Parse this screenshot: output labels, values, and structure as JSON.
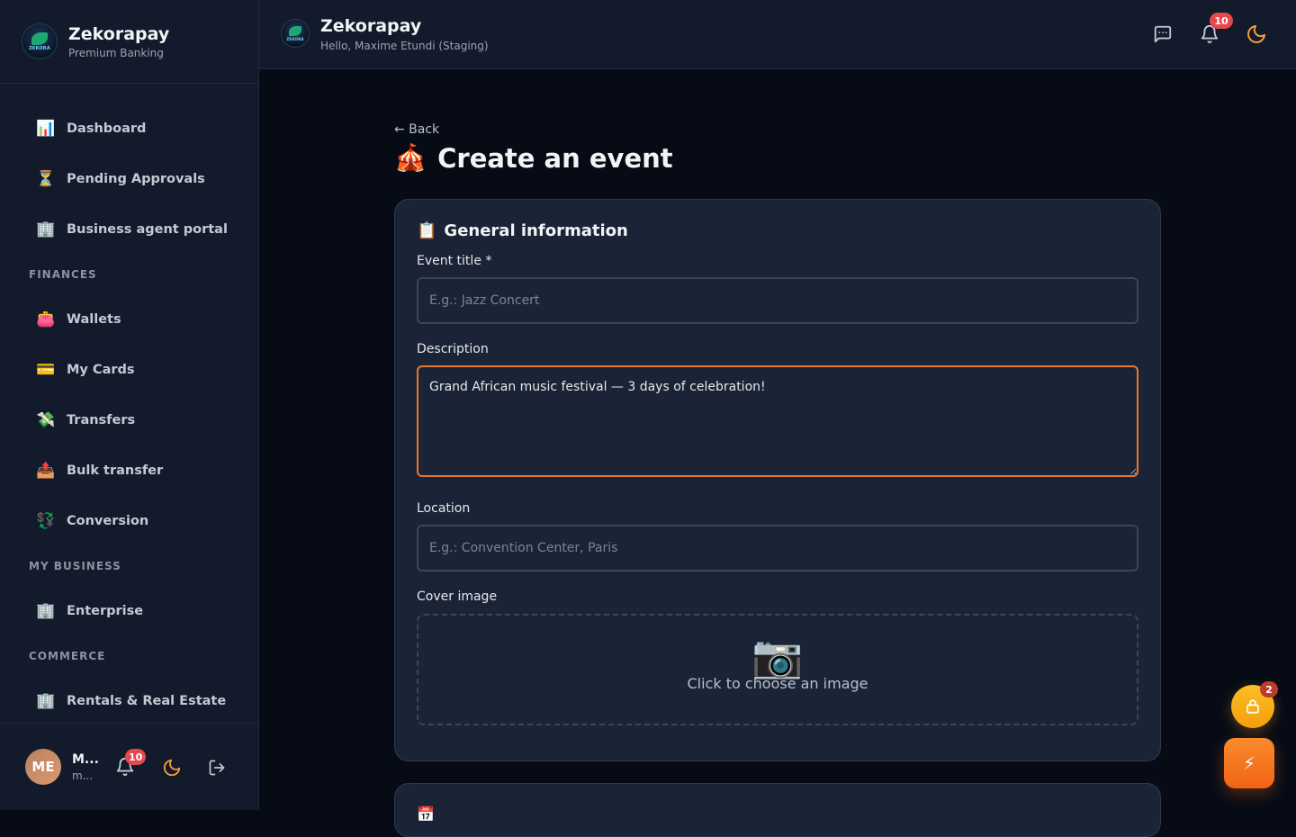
{
  "brand": {
    "name": "Zekorapay",
    "tagline": "Premium Banking",
    "logo_text": "ZEKORA"
  },
  "sidebar": {
    "items": [
      {
        "label": "Dashboard",
        "icon": "📊"
      },
      {
        "label": "Pending Approvals",
        "icon": "⏳"
      },
      {
        "label": "Business agent portal",
        "icon": "🏢"
      }
    ],
    "finances_heading": "FINANCES",
    "finances": [
      {
        "label": "Wallets",
        "icon": "👛"
      },
      {
        "label": "My Cards",
        "icon": "💳"
      },
      {
        "label": "Transfers",
        "icon": "💸"
      },
      {
        "label": "Bulk transfer",
        "icon": "📤"
      },
      {
        "label": "Conversion",
        "icon": "💱"
      }
    ],
    "business_heading": "MY BUSINESS",
    "business": [
      {
        "label": "Enterprise",
        "icon": "🏢"
      }
    ],
    "commerce_heading": "COMMERCE",
    "commerce": [
      {
        "label": "Rentals & Real Estate",
        "icon": "🏢"
      }
    ]
  },
  "user": {
    "initials": "ME",
    "name": "M...",
    "email": "m...",
    "notifications": "10"
  },
  "topbar": {
    "title": "Zekorapay",
    "greeting": "Hello, Maxime Etundi (Staging)",
    "notifications": "10"
  },
  "page": {
    "back": "← Back",
    "title_icon": "🎪",
    "title": "Create an event"
  },
  "form": {
    "section_icon": "📋",
    "section_title": "General information",
    "event_title_label": "Event title *",
    "event_title_placeholder": "E.g.: Jazz Concert",
    "event_title_value": "",
    "description_label": "Description",
    "description_value": "Grand African music festival — 3 days of celebration!",
    "location_label": "Location",
    "location_placeholder": "E.g.: Convention Center, Paris",
    "location_value": "",
    "cover_label": "Cover image",
    "cover_icon": "📷",
    "cover_text": "Click to choose an image"
  },
  "next_section_icon": "📅",
  "floating": {
    "lock_badge": "2",
    "bolt": "⚡"
  },
  "colors": {
    "accent": "#f06414",
    "badge": "#e5484d",
    "moon": "#f59e3b"
  }
}
